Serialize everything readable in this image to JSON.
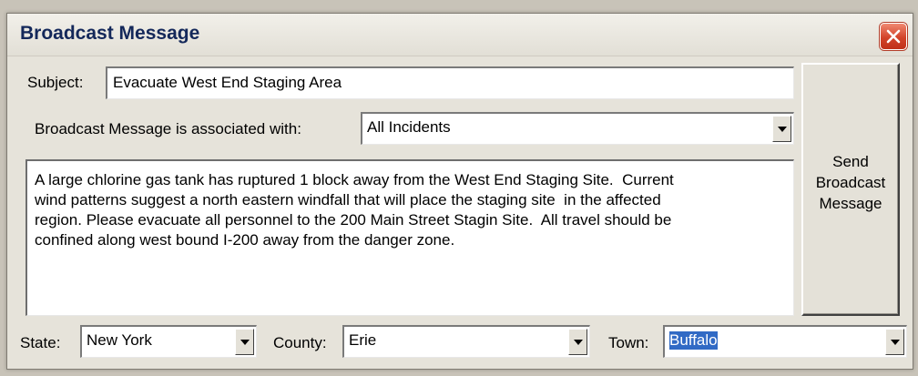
{
  "window": {
    "title": "Broadcast Message"
  },
  "subject": {
    "label": "Subject:",
    "value": "Evacuate West End Staging Area"
  },
  "association": {
    "label": "Broadcast Message is associated with:",
    "value": "All Incidents"
  },
  "message": {
    "body": "A large chlorine gas tank has ruptured 1 block away from the West End Staging Site.  Current\nwind patterns suggest a north eastern windfall that will place the staging site  in the affected\nregion. Please evacuate all personnel to the 200 Main Street Stagin Site.  All travel should be\nconfined along west bound I-200 away from the danger zone."
  },
  "send_button": {
    "label": "Send\nBroadcast\nMessage"
  },
  "location": {
    "state_label": "State:",
    "state_value": "New York",
    "county_label": "County:",
    "county_value": "Erie",
    "town_label": "Town:",
    "town_value": "Buffalo"
  },
  "icons": {
    "close": "close-icon",
    "dropdown": "chevron-down-icon"
  },
  "colors": {
    "title_text": "#14285a",
    "close_button": "#d2432a",
    "selection": "#316ac5"
  }
}
